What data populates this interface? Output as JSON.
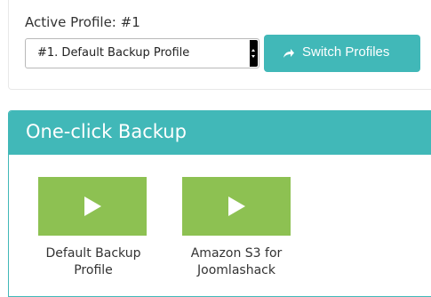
{
  "profile": {
    "active_label": "Active Profile: #1",
    "selected_option": "#1. Default Backup Profile",
    "switch_button": "Switch Profiles"
  },
  "one_click": {
    "title": "One-click Backup",
    "items": [
      {
        "label": "Default Backup Profile",
        "line1": "Default Backup",
        "line2": "Profile"
      },
      {
        "label": "Amazon S3 for Joomlashack",
        "line1": "Amazon S3 for",
        "line2": "Joomlashack"
      }
    ]
  },
  "colors": {
    "accent": "#41b8b8",
    "play_green": "#8dc152"
  },
  "icons": {
    "switch": "share-arrow-icon",
    "play": "play-icon",
    "select": "dropdown-arrows-icon"
  }
}
